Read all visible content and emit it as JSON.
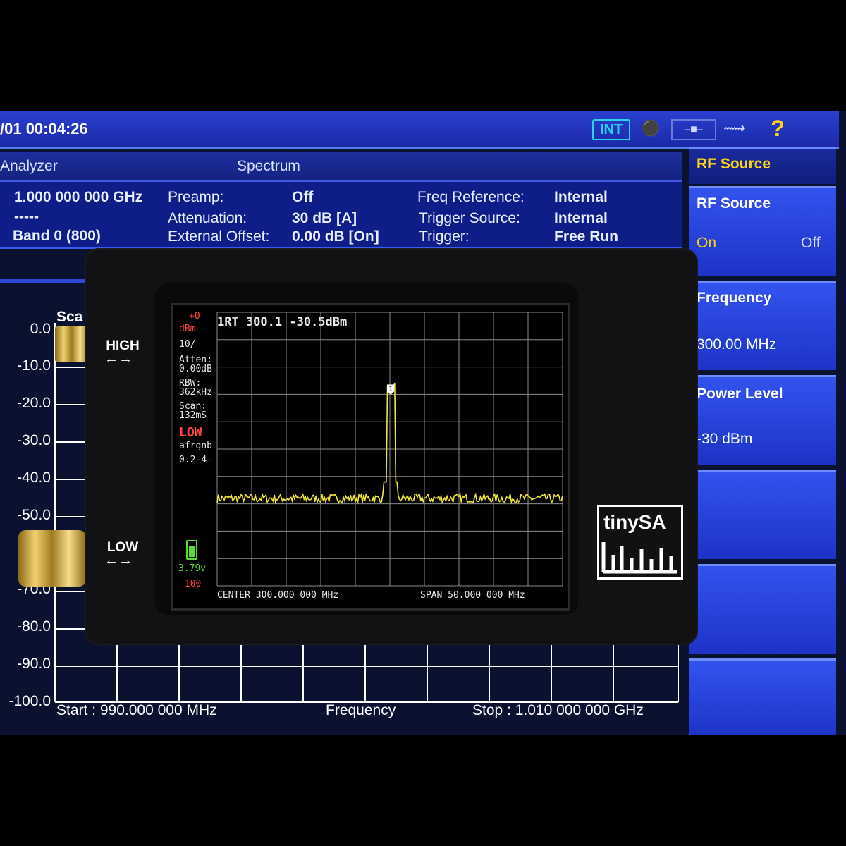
{
  "titlebar": {
    "datetime": "/01 00:04:26",
    "int_badge": "INT",
    "help_icon": "?"
  },
  "modebar": {
    "mode": "Analyzer",
    "view": "Spectrum"
  },
  "info": {
    "center_freq": "1.000 000 000 GHz",
    "dashes": "-----",
    "band": "Band 0 (800)",
    "preamp_label": "Preamp:",
    "preamp_value": "Off",
    "atten_label": "Attenuation:",
    "atten_value": "30 dB  [A]",
    "extoff_label": "External Offset:",
    "extoff_value": "0.00 dB  [On]",
    "freqref_label": "Freq Reference:",
    "freqref_value": "Internal",
    "trigsrc_label": "Trigger Source:",
    "trigsrc_value": "Internal",
    "trig_label": "Trigger:",
    "trig_value": "Free Run"
  },
  "softkeys": {
    "header": "RF Source",
    "rf_source_label": "RF Source",
    "rf_on": "On",
    "rf_off": "Off",
    "frequency_label": "Frequency",
    "frequency_value": "300.00 MHz",
    "power_label": "Power Level",
    "power_value": "-30 dBm"
  },
  "plot": {
    "scale_partial": "Sca",
    "y_ticks": [
      "0.0",
      "-10.0",
      "-20.0",
      "-30.0",
      "-40.0",
      "-50.0",
      "-70.0",
      "-80.0",
      "-90.0",
      "-100.0"
    ],
    "start": "Start : 990.000 000 MHz",
    "center_label": "Frequency",
    "stop": "Stop : 1.010 000 000 GHz"
  },
  "device": {
    "high_label": "HIGH",
    "low_label": "LOW",
    "logo_text": "tinySA",
    "lcd": {
      "ref_level": "+0",
      "unit": "dBm",
      "scale": "10/",
      "atten_label": "Atten:",
      "atten_value": "0.00dB",
      "rbw_label": "RBW:",
      "rbw_value": "362kHz",
      "scan_label": "Scan:",
      "scan_value": "132mS",
      "mode": "LOW",
      "flags": "afrgnb",
      "version": "0.2-4-",
      "battery_voltage": "3.79v",
      "bottom_level": "-100",
      "marker_readout": "1RT  300.1 -30.5dBm",
      "marker_id": "1",
      "center": "CENTER 300.000 000 MHz",
      "span": "SPAN 50.000 000 MHz",
      "trace_color": "#f2e53a",
      "grid_color": "#8a8a8a"
    }
  },
  "chart_data": {
    "type": "line",
    "x_range_mhz": [
      275,
      325
    ],
    "ylim": [
      -100,
      0
    ],
    "y_step": 10,
    "noise_floor_dbm": -68,
    "peak": {
      "x": 300.1,
      "y": -30.5
    }
  }
}
